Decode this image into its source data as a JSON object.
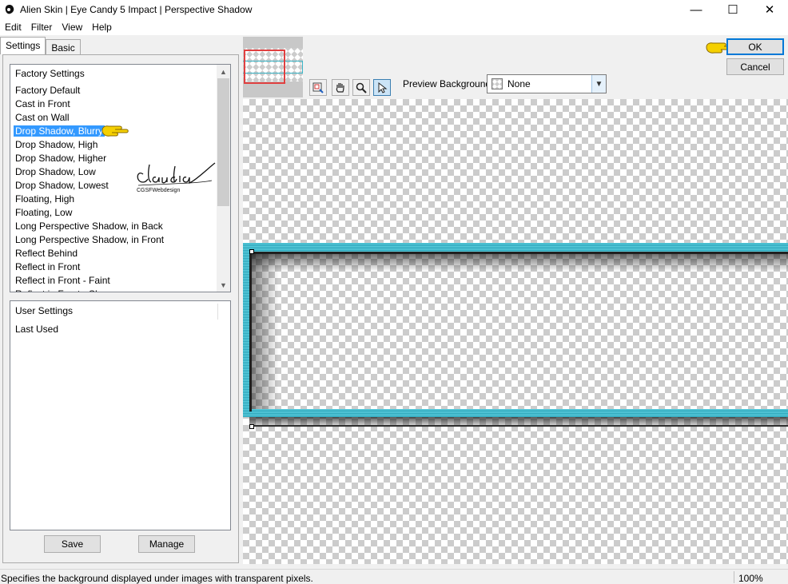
{
  "window": {
    "title": "Alien Skin | Eye Candy 5 Impact | Perspective Shadow",
    "minimize_glyph": "—",
    "maximize_glyph": "☐",
    "close_glyph": "✕"
  },
  "menu": {
    "items": [
      "Edit",
      "Filter",
      "View",
      "Help"
    ]
  },
  "tabs": {
    "settings": "Settings",
    "basic": "Basic"
  },
  "factory": {
    "header": "Factory Settings",
    "items": [
      "Factory Default",
      "Cast in Front",
      "Cast on Wall",
      "Drop Shadow, Blurry",
      "Drop Shadow, High",
      "Drop Shadow, Higher",
      "Drop Shadow, Low",
      "Drop Shadow, Lowest",
      "Floating, High",
      "Floating, Low",
      "Long Perspective Shadow, in Back",
      "Long Perspective Shadow, in Front",
      "Reflect Behind",
      "Reflect in Front",
      "Reflect in Front - Faint",
      "Reflect in Front - Sharp"
    ],
    "selected_index": 3
  },
  "user": {
    "header": "User Settings",
    "items": [
      "Last Used"
    ]
  },
  "buttons": {
    "save": "Save",
    "manage": "Manage",
    "ok": "OK",
    "cancel": "Cancel"
  },
  "signature": {
    "name": "claudia",
    "sub": "CGSFWebdesign"
  },
  "preview": {
    "background_label": "Preview Background:",
    "background_value": "None"
  },
  "status": {
    "text": "Specifies the background displayed under images with transparent pixels.",
    "zoom": "100%"
  },
  "colors": {
    "selection": "#3399ff",
    "frame_cyan": "#2aa3b8",
    "ok_border": "#0078d7",
    "pointer_hand": "#f5d000"
  },
  "icons": [
    "app-icon",
    "navigator-icon",
    "hand-tool-icon",
    "zoom-tool-icon",
    "pointer-tool-icon",
    "pointing-hand-icon"
  ]
}
